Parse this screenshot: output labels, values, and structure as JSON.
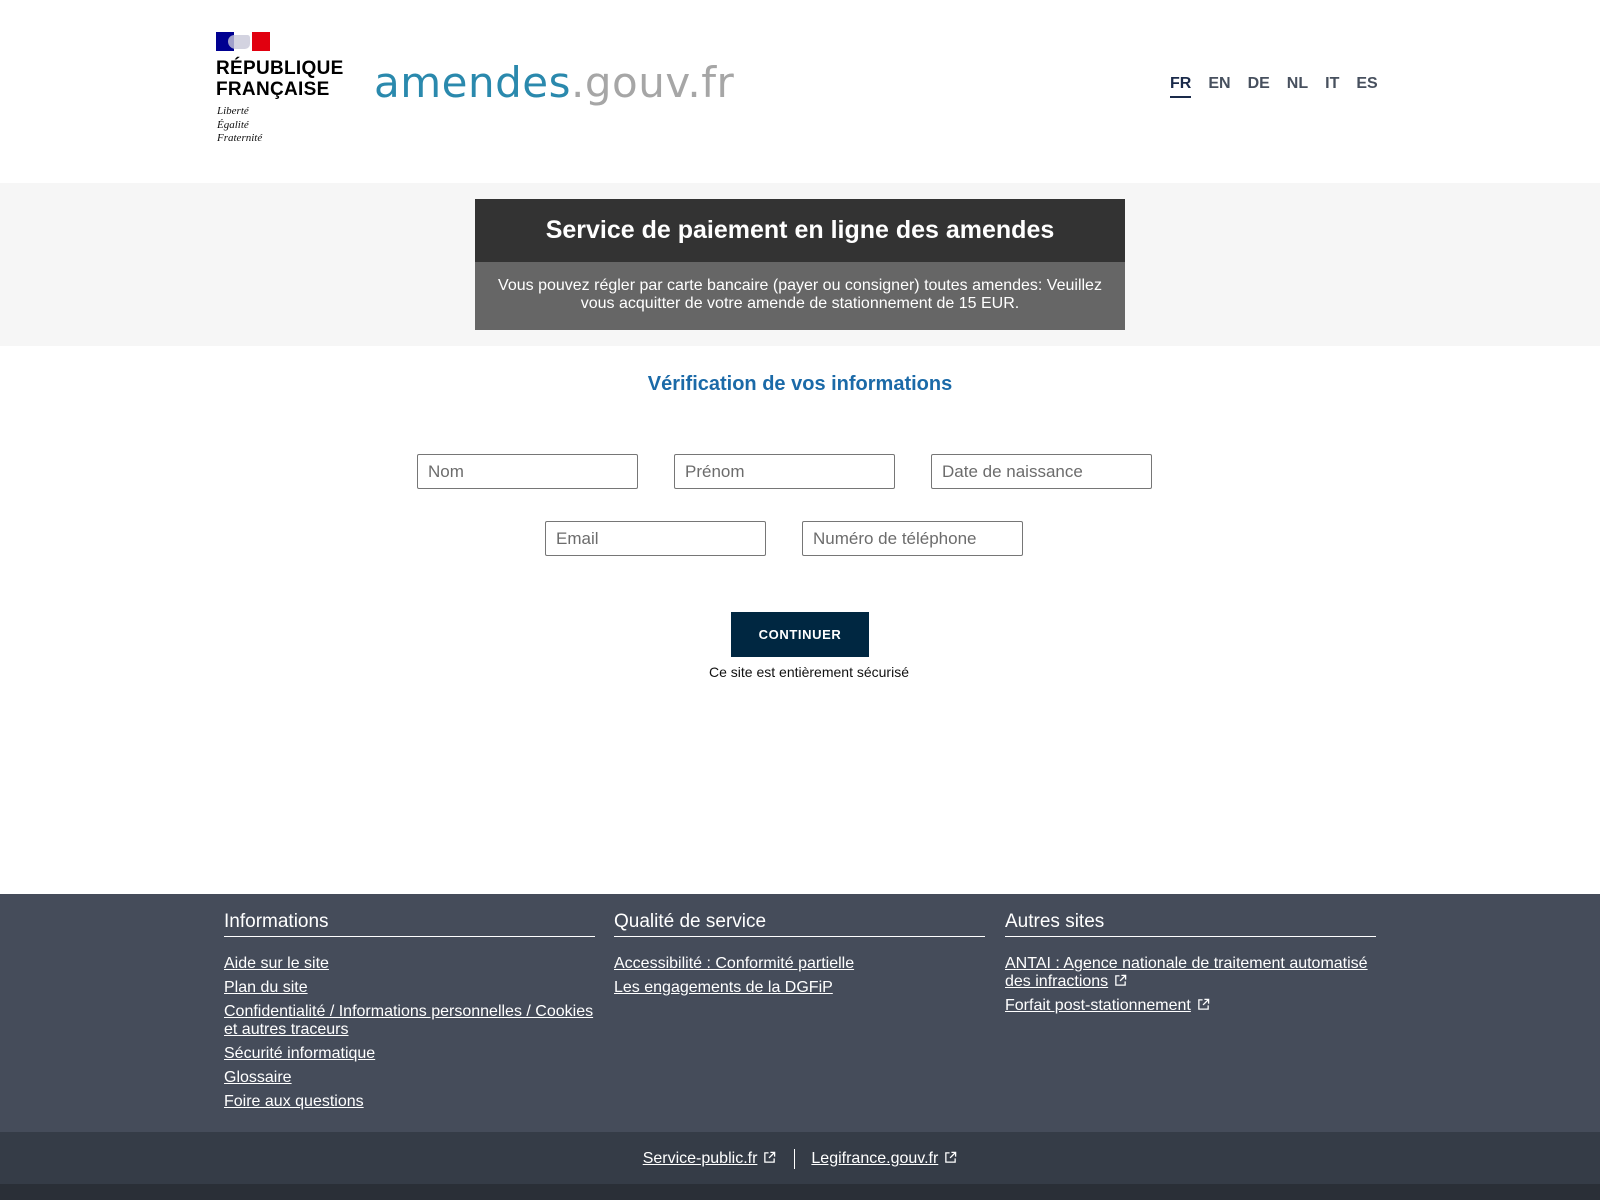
{
  "header": {
    "republic_line1": "RÉPUBLIQUE",
    "republic_line2": "FRANÇAISE",
    "motto_1": "Liberté",
    "motto_2": "Égalité",
    "motto_3": "Fraternité",
    "site_name_part1": "amendes",
    "site_name_part2": ".gouv.fr",
    "languages": [
      "FR",
      "EN",
      "DE",
      "NL",
      "IT",
      "ES"
    ],
    "active_language": "FR"
  },
  "banner": {
    "title": "Service de paiement en ligne des amendes",
    "text_line1": "Vous pouvez régler par carte bancaire (payer ou consigner) toutes amendes: Veuillez",
    "text_line2": "vous acquitter de votre amende de stationnement de 15 EUR."
  },
  "form": {
    "title": "Vérification de vos informations",
    "nom_placeholder": "Nom",
    "prenom_placeholder": "Prénom",
    "naissance_placeholder": "Date de naissance",
    "email_placeholder": "Email",
    "telephone_placeholder": "Numéro de téléphone",
    "submit_label": "CONTINUER",
    "secure_note": "Ce site est entièrement sécurisé"
  },
  "footer": {
    "informations": {
      "heading": "Informations",
      "links": [
        "Aide sur le site",
        "Plan du site",
        "Confidentialité / Informations personnelles / Cookies et autres traceurs",
        "Sécurité informatique",
        "Glossaire",
        "Foire aux questions"
      ]
    },
    "qualite": {
      "heading": "Qualité de service",
      "links": [
        "Accessibilité : Conformité partielle",
        "Les engagements de la DGFiP"
      ]
    },
    "autres": {
      "heading": "Autres sites",
      "links": [
        "ANTAI : Agence nationale de traitement automatisé des infractions",
        "Forfait post-stationnement"
      ]
    },
    "bottom_links": [
      "Service-public.fr",
      "Legifrance.gouv.fr"
    ]
  },
  "colors": {
    "site_name_blue": "#2a89ad",
    "site_name_grey": "#a6a6a6",
    "form_title_blue": "#1b6aa8",
    "button_navy": "#002741",
    "footer_bg": "#454c5a",
    "footer_bottom_bg": "#353c47",
    "flag_blue": "#000091",
    "flag_red": "#e1000f"
  }
}
